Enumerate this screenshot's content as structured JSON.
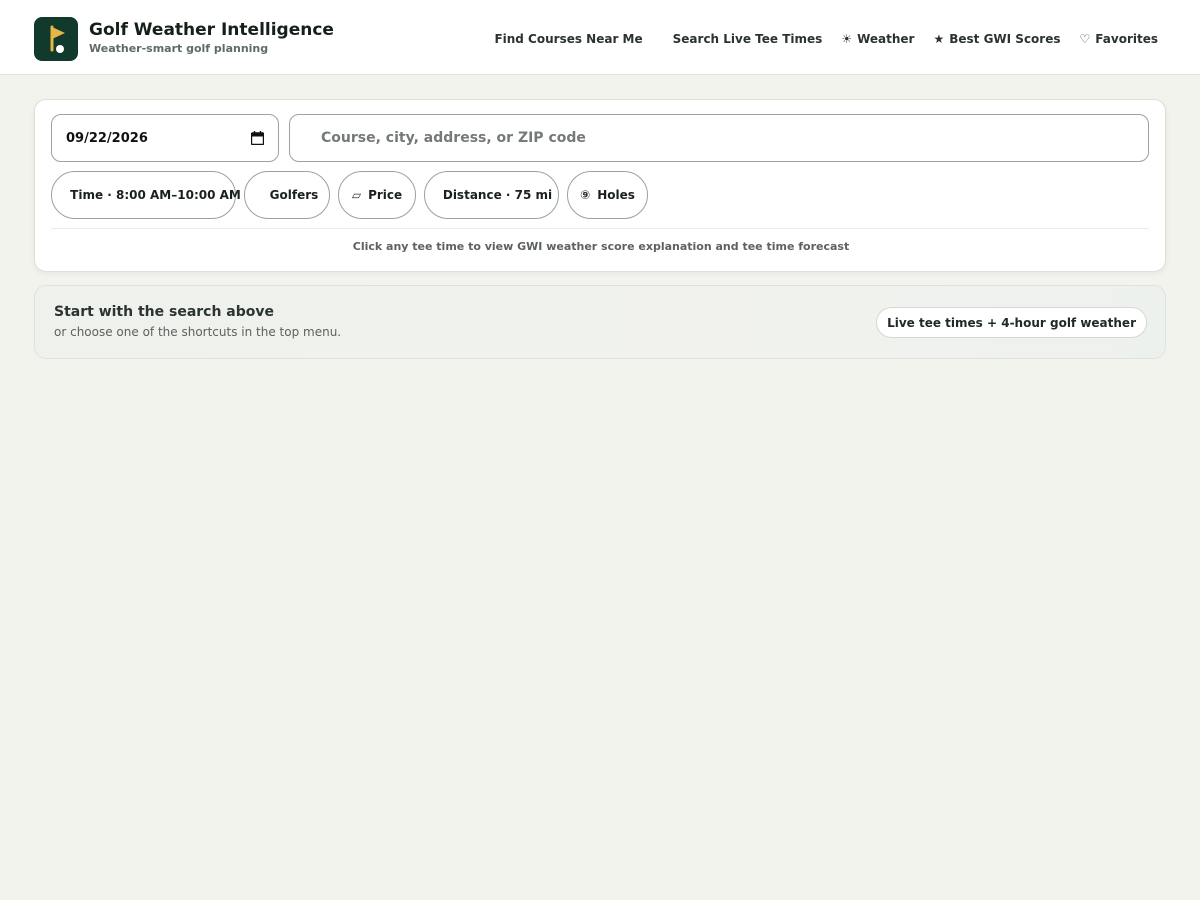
{
  "brand": {
    "title": "Golf Weather Intelligence",
    "subtitle": "Weather-smart golf planning",
    "logo_icon": "flag-icon",
    "logo_color": "#123a2c",
    "accent_color": "#e8b547"
  },
  "nav": [
    {
      "label": "Find Courses Near Me",
      "icon": ""
    },
    {
      "label": "Search Live Tee Times",
      "icon": ""
    },
    {
      "label": "Weather",
      "icon": "sun-icon",
      "glyph": "☀"
    },
    {
      "label": "Best GWI Scores",
      "icon": "star-icon",
      "glyph": "★"
    },
    {
      "label": "Favorites",
      "icon": "heart-icon",
      "glyph": "♡"
    }
  ],
  "search": {
    "date_value": "09/22/2026",
    "location_placeholder": "Course, city, address, or ZIP code",
    "filters": {
      "time": "Time · 8:00 AM–10:00 AM",
      "golfers": "Golfers",
      "price": "Price",
      "price_glyph": "▱",
      "distance": "Distance · 75 mi",
      "holes": "Holes",
      "holes_glyph": "⑨"
    },
    "hint": "Click any tee time to view GWI weather score explanation and tee time forecast"
  },
  "start": {
    "title": "Start with the search above",
    "subtitle": "or choose one of the shortcuts in the top menu.",
    "badge": "Live tee times + 4-hour golf weather"
  }
}
